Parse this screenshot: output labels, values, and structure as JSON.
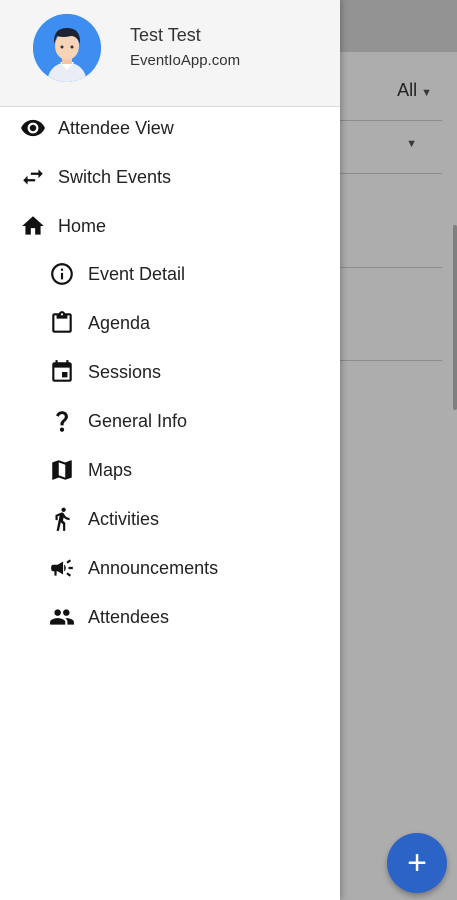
{
  "background": {
    "filter_label": "All"
  },
  "drawer": {
    "user": {
      "name": "Test Test",
      "email": "EventIoApp.com"
    },
    "top_items": [
      {
        "label": "Attendee View",
        "icon": "eye-icon"
      },
      {
        "label": "Switch Events",
        "icon": "swap-arrows-icon"
      },
      {
        "label": "Home",
        "icon": "home-icon"
      }
    ],
    "sub_items": [
      {
        "label": "Event Detail",
        "icon": "info-icon"
      },
      {
        "label": "Agenda",
        "icon": "clipboard-icon"
      },
      {
        "label": "Sessions",
        "icon": "calendar-icon"
      },
      {
        "label": "General Info",
        "icon": "question-icon"
      },
      {
        "label": "Maps",
        "icon": "map-icon"
      },
      {
        "label": "Activities",
        "icon": "walk-icon"
      },
      {
        "label": "Announcements",
        "icon": "megaphone-icon"
      },
      {
        "label": "Attendees",
        "icon": "people-icon"
      }
    ]
  },
  "fab": {
    "icon": "plus-icon",
    "color": "#2b63c7"
  },
  "colors": {
    "accent": "#2b63c7",
    "avatar_bg": "#3d8ef0"
  }
}
